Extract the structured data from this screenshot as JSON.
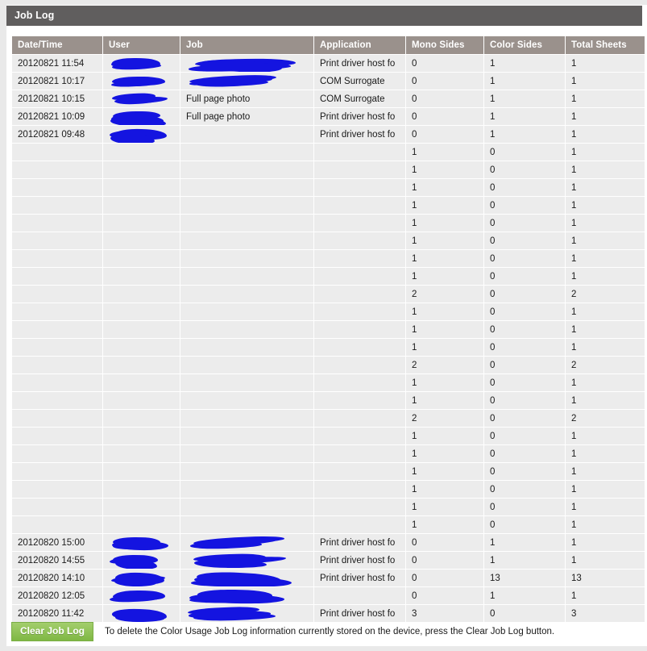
{
  "window": {
    "title": "Job Log"
  },
  "table": {
    "columns": [
      {
        "key": "datetime",
        "label": "Date/Time"
      },
      {
        "key": "user",
        "label": "User"
      },
      {
        "key": "job",
        "label": "Job"
      },
      {
        "key": "application",
        "label": "Application"
      },
      {
        "key": "mono_sides",
        "label": "Mono Sides"
      },
      {
        "key": "color_sides",
        "label": "Color Sides"
      },
      {
        "key": "total_sheets",
        "label": "Total Sheets"
      }
    ],
    "rows": [
      {
        "datetime": "20120821 11:54",
        "user": "",
        "job": "",
        "application": "Print driver host fo",
        "mono_sides": "0",
        "color_sides": "1",
        "total_sheets": "1",
        "redacted": [
          "user",
          "job"
        ]
      },
      {
        "datetime": "20120821 10:17",
        "user": "",
        "job": "",
        "application": "COM Surrogate",
        "mono_sides": "0",
        "color_sides": "1",
        "total_sheets": "1",
        "redacted": [
          "user",
          "job"
        ]
      },
      {
        "datetime": "20120821 10:15",
        "user": "",
        "job": "Full page photo",
        "application": "COM Surrogate",
        "mono_sides": "0",
        "color_sides": "1",
        "total_sheets": "1",
        "redacted": [
          "user"
        ]
      },
      {
        "datetime": "20120821 10:09",
        "user": "",
        "job": "Full page photo",
        "application": "Print driver host fo",
        "mono_sides": "0",
        "color_sides": "1",
        "total_sheets": "1",
        "redacted": [
          "user"
        ]
      },
      {
        "datetime": "20120821 09:48",
        "user": "",
        "job": "",
        "application": "Print driver host fo",
        "mono_sides": "0",
        "color_sides": "1",
        "total_sheets": "1",
        "redacted": [
          "user"
        ]
      },
      {
        "datetime": "",
        "user": "",
        "job": "",
        "application": "",
        "mono_sides": "1",
        "color_sides": "0",
        "total_sheets": "1",
        "redacted": []
      },
      {
        "datetime": "",
        "user": "",
        "job": "",
        "application": "",
        "mono_sides": "1",
        "color_sides": "0",
        "total_sheets": "1",
        "redacted": []
      },
      {
        "datetime": "",
        "user": "",
        "job": "",
        "application": "",
        "mono_sides": "1",
        "color_sides": "0",
        "total_sheets": "1",
        "redacted": []
      },
      {
        "datetime": "",
        "user": "",
        "job": "",
        "application": "",
        "mono_sides": "1",
        "color_sides": "0",
        "total_sheets": "1",
        "redacted": []
      },
      {
        "datetime": "",
        "user": "",
        "job": "",
        "application": "",
        "mono_sides": "1",
        "color_sides": "0",
        "total_sheets": "1",
        "redacted": []
      },
      {
        "datetime": "",
        "user": "",
        "job": "",
        "application": "",
        "mono_sides": "1",
        "color_sides": "0",
        "total_sheets": "1",
        "redacted": []
      },
      {
        "datetime": "",
        "user": "",
        "job": "",
        "application": "",
        "mono_sides": "1",
        "color_sides": "0",
        "total_sheets": "1",
        "redacted": []
      },
      {
        "datetime": "",
        "user": "",
        "job": "",
        "application": "",
        "mono_sides": "1",
        "color_sides": "0",
        "total_sheets": "1",
        "redacted": []
      },
      {
        "datetime": "",
        "user": "",
        "job": "",
        "application": "",
        "mono_sides": "2",
        "color_sides": "0",
        "total_sheets": "2",
        "redacted": []
      },
      {
        "datetime": "",
        "user": "",
        "job": "",
        "application": "",
        "mono_sides": "1",
        "color_sides": "0",
        "total_sheets": "1",
        "redacted": []
      },
      {
        "datetime": "",
        "user": "",
        "job": "",
        "application": "",
        "mono_sides": "1",
        "color_sides": "0",
        "total_sheets": "1",
        "redacted": []
      },
      {
        "datetime": "",
        "user": "",
        "job": "",
        "application": "",
        "mono_sides": "1",
        "color_sides": "0",
        "total_sheets": "1",
        "redacted": []
      },
      {
        "datetime": "",
        "user": "",
        "job": "",
        "application": "",
        "mono_sides": "2",
        "color_sides": "0",
        "total_sheets": "2",
        "redacted": []
      },
      {
        "datetime": "",
        "user": "",
        "job": "",
        "application": "",
        "mono_sides": "1",
        "color_sides": "0",
        "total_sheets": "1",
        "redacted": []
      },
      {
        "datetime": "",
        "user": "",
        "job": "",
        "application": "",
        "mono_sides": "1",
        "color_sides": "0",
        "total_sheets": "1",
        "redacted": []
      },
      {
        "datetime": "",
        "user": "",
        "job": "",
        "application": "",
        "mono_sides": "2",
        "color_sides": "0",
        "total_sheets": "2",
        "redacted": []
      },
      {
        "datetime": "",
        "user": "",
        "job": "",
        "application": "",
        "mono_sides": "1",
        "color_sides": "0",
        "total_sheets": "1",
        "redacted": []
      },
      {
        "datetime": "",
        "user": "",
        "job": "",
        "application": "",
        "mono_sides": "1",
        "color_sides": "0",
        "total_sheets": "1",
        "redacted": []
      },
      {
        "datetime": "",
        "user": "",
        "job": "",
        "application": "",
        "mono_sides": "1",
        "color_sides": "0",
        "total_sheets": "1",
        "redacted": []
      },
      {
        "datetime": "",
        "user": "",
        "job": "",
        "application": "",
        "mono_sides": "1",
        "color_sides": "0",
        "total_sheets": "1",
        "redacted": []
      },
      {
        "datetime": "",
        "user": "",
        "job": "",
        "application": "",
        "mono_sides": "1",
        "color_sides": "0",
        "total_sheets": "1",
        "redacted": []
      },
      {
        "datetime": "",
        "user": "",
        "job": "",
        "application": "",
        "mono_sides": "1",
        "color_sides": "0",
        "total_sheets": "1",
        "redacted": []
      },
      {
        "datetime": "20120820 15:00",
        "user": "",
        "job": "",
        "application": "Print driver host fo",
        "mono_sides": "0",
        "color_sides": "1",
        "total_sheets": "1",
        "redacted": [
          "user",
          "job"
        ]
      },
      {
        "datetime": "20120820 14:55",
        "user": "",
        "job": "",
        "application": "Print driver host fo",
        "mono_sides": "0",
        "color_sides": "1",
        "total_sheets": "1",
        "redacted": [
          "user",
          "job"
        ]
      },
      {
        "datetime": "20120820 14:10",
        "user": "",
        "job": "",
        "application": "Print driver host fo",
        "mono_sides": "0",
        "color_sides": "13",
        "total_sheets": "13",
        "redacted": [
          "user",
          "job"
        ]
      },
      {
        "datetime": "20120820 12:05",
        "user": "",
        "job": "",
        "application": "",
        "mono_sides": "0",
        "color_sides": "1",
        "total_sheets": "1",
        "redacted": [
          "user",
          "job"
        ]
      },
      {
        "datetime": "20120820 11:42",
        "user": "",
        "job": "",
        "application": "Print driver host fo",
        "mono_sides": "3",
        "color_sides": "0",
        "total_sheets": "3",
        "redacted": [
          "user",
          "job"
        ]
      }
    ]
  },
  "footer": {
    "clear_button_label": "Clear Job Log",
    "note": "To delete the Color Usage Job Log information currently stored on the device, press the Clear Job Log button."
  },
  "colors": {
    "titlebar_bg": "#605e5e",
    "header_bg": "#9a918c",
    "cell_bg": "#ececec",
    "redaction": "#1414e0",
    "button_green": "#8dc152"
  }
}
